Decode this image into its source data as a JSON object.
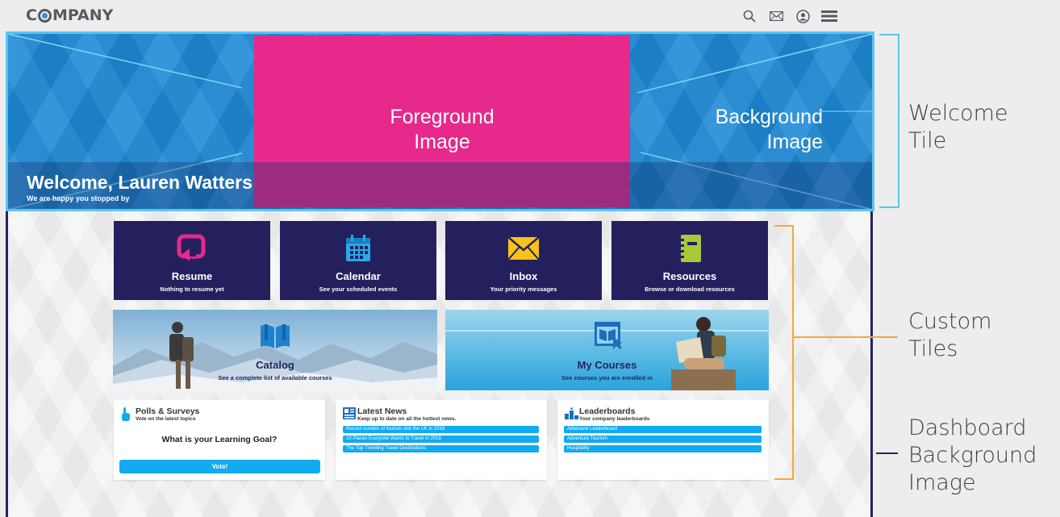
{
  "header": {
    "logo_before": "C",
    "logo_after": "MPANY",
    "icons": [
      "search-icon",
      "mail-icon",
      "user-icon",
      "menu-icon"
    ]
  },
  "welcome": {
    "title": "Welcome, Lauren Watters",
    "subtitle": "We are happy you stopped by",
    "foreground_label_1": "Foreground",
    "foreground_label_2": "Image",
    "background_label_1": "Background",
    "background_label_2": "Image"
  },
  "annotations": {
    "welcome_1": "Welcome",
    "welcome_2": "Tile",
    "custom_1": "Custom",
    "custom_2": "Tiles",
    "dash_1": "Dashboard",
    "dash_2": "Background",
    "dash_3": "Image"
  },
  "tiles": [
    {
      "title": "Resume",
      "subtitle": "Nothing to resume yet",
      "icon": "resume-icon"
    },
    {
      "title": "Calendar",
      "subtitle": "See your scheduled events",
      "icon": "calendar-icon"
    },
    {
      "title": "Inbox",
      "subtitle": "Your priority messages",
      "icon": "envelope-icon"
    },
    {
      "title": "Resources",
      "subtitle": "Browse or download resources",
      "icon": "notebook-icon"
    }
  ],
  "image_tiles": [
    {
      "title": "Catalog",
      "subtitle": "See a complete list of available courses",
      "icon": "book-icon"
    },
    {
      "title": "My Courses",
      "subtitle": "See courses you are enrolled in",
      "icon": "course-icon"
    }
  ],
  "polls": {
    "title": "Polls & Surveys",
    "subtitle": "Vote on the latest topics",
    "question": "What is your Learning Goal?",
    "button": "Vote!"
  },
  "news": {
    "title": "Latest News",
    "subtitle": "Keep up to date on all the hottest news.",
    "items": [
      "Record number of tourists visit the UK in 2018",
      "10 Places Everyone Wants to Travel in 2018",
      "The Top Trending Travel Destinations"
    ]
  },
  "leaderboards": {
    "title": "Leaderboards",
    "subtitle": "Your company leaderboards",
    "items": [
      "Alltatravel Leaderboard",
      "Adventure Tourism",
      "Hospitality"
    ]
  },
  "colors": {
    "navy": "#24205e",
    "welcome_blue": "#1f8ad6",
    "foreground_pink": "#e6298a",
    "annotation_blue": "#5bc4f0",
    "annotation_orange": "#f2a93b",
    "button_blue": "#12aaf0"
  }
}
